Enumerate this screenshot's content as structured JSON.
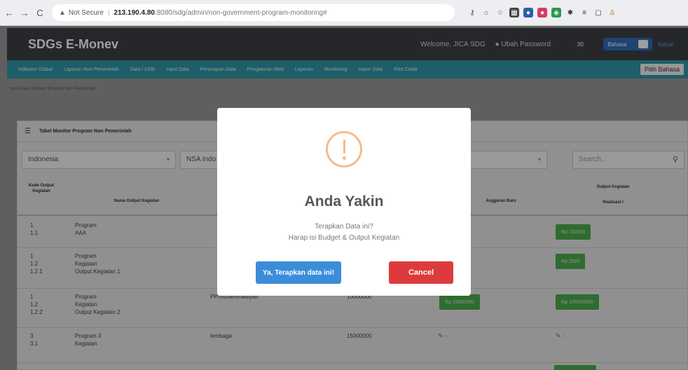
{
  "browser": {
    "back": "←",
    "forward": "→",
    "reload": "C",
    "security_label": "Not Secure",
    "host": "213.190.4.80",
    "path": ":8080/sdg/admin/non-government-program-monitoring#",
    "ext_icons": [
      "key-icon",
      "account-icon",
      "star-icon",
      "grid-icon",
      "extension-icon",
      "extension-icon",
      "extension-icon",
      "puzzle-icon",
      "list-icon",
      "window-icon",
      "profile-icon"
    ]
  },
  "header": {
    "brand": "SDGs E-Monev",
    "welcome": "Welcome, JICA SDG",
    "change_password": "Ubah Password",
    "language_toggle": "Bahasa",
    "logout": "Keluar"
  },
  "menu": {
    "items": [
      "Indikator Global",
      "Laporan Non-Pemerintah",
      "Data / LKBI",
      "Input Data",
      "Penerapan Data",
      "Pengaturan Web",
      "Laporan",
      "Monitoring",
      "Impor Data",
      "Pilot Cetak"
    ],
    "language_select": "Pilih Bahasa"
  },
  "breadcrumb": "Input Data / Monitor Program Non Pemerintah",
  "panel": {
    "title": "Tabel Monitor Program Non Pemerintah",
    "filter_country": "Indonesia",
    "filter_org": "NSA Indo",
    "search_placeholder": "Search..."
  },
  "table": {
    "header_kode": "Kode Output Kegiatan",
    "header_nama": "Nama Output Kegiatan",
    "header_anggaran": "Anggaran Baru",
    "header_output_group": "Output Kegiatan",
    "header_realisasi": "Realisasi I",
    "rows": [
      {
        "code": "1\n1.1",
        "name": "Program\nAAA",
        "pj": "",
        "budget": "",
        "btn2": "Rp 100000"
      },
      {
        "code": "1\n1.2\n1.2.1",
        "name": "Program\nKegiatan\nOutput Kegiatan 1",
        "pj": "",
        "budget": "",
        "btn2": "Rp 2000"
      },
      {
        "code": "1\n1.2\n1.2.2",
        "name": "Program\nKegiatan\nOutput Kegiatan 2",
        "pj": "PP.muhammadiyah",
        "budget": "10000000",
        "btn1": "Rp 10000000",
        "btn2": "Rp 100000000"
      },
      {
        "code": "3\n3.1",
        "name": "Program 3\nKegiatan",
        "pj": "lembaga",
        "budget": "15000000",
        "edit1": "✎ -",
        "edit2": "✎ -"
      }
    ]
  },
  "modal": {
    "title": "Anda Yakin",
    "line1": "Terapkan Data ini?",
    "line2": "Harap isi Budget & Output Kegiatan",
    "confirm": "Ya, Terapkan data ini!",
    "cancel": "Cancel"
  },
  "colors": {
    "menu_bar": "#2f98a8",
    "confirm": "#3c8dd9",
    "cancel": "#dd3b3b",
    "warning": "#f8bb86",
    "green_button": "#4cae4c"
  }
}
